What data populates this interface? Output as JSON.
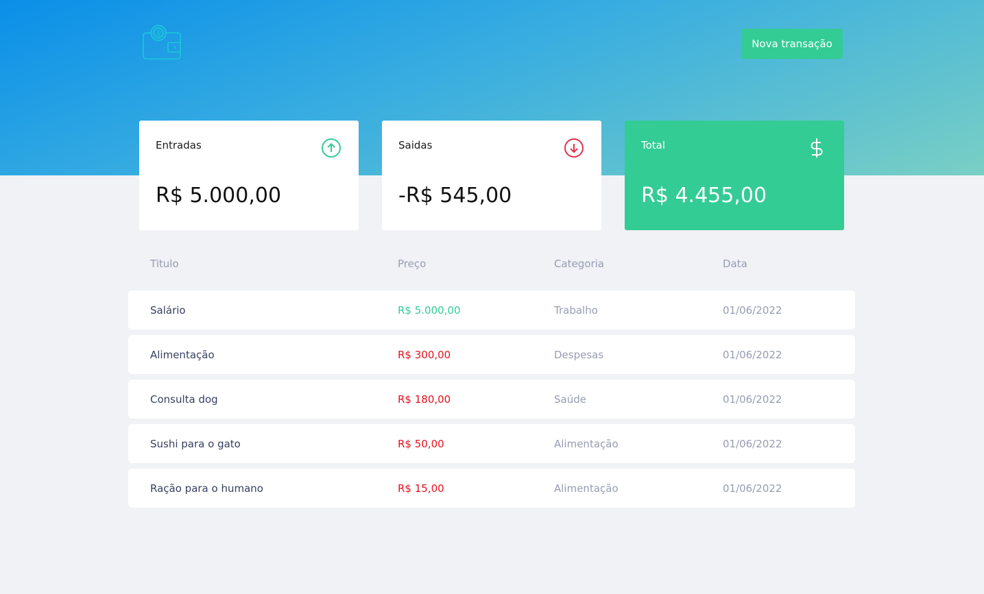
{
  "header": {
    "logo_icon": "wallet-dollar-icon",
    "new_transaction_label": "Nova transação"
  },
  "summary": {
    "income": {
      "label": "Entradas",
      "value": "R$ 5.000,00",
      "icon": "arrow-up-circle-icon",
      "color": "#33cc95"
    },
    "outcome": {
      "label": "Saidas",
      "value": "-R$ 545,00",
      "icon": "arrow-down-circle-icon",
      "color": "#e52e4d"
    },
    "total": {
      "label": "Total",
      "value": "R$ 4.455,00",
      "icon": "dollar-sign-icon",
      "color": "#33cc95"
    }
  },
  "table": {
    "headers": {
      "title": "Titulo",
      "price": "Preço",
      "category": "Categoria",
      "date": "Data"
    },
    "rows": [
      {
        "title": "Salário",
        "price": "R$ 5.000,00",
        "type": "deposit",
        "category": "Trabalho",
        "date": "01/06/2022"
      },
      {
        "title": "Alimentação",
        "price": "R$ 300,00",
        "type": "withdraw",
        "category": "Despesas",
        "date": "01/06/2022"
      },
      {
        "title": "Consulta dog",
        "price": "R$ 180,00",
        "type": "withdraw",
        "category": "Saúde",
        "date": "01/06/2022"
      },
      {
        "title": "Sushi para o gato",
        "price": "R$ 50,00",
        "type": "withdraw",
        "category": "Alimentação",
        "date": "01/06/2022"
      },
      {
        "title": "Ração para o humano",
        "price": "R$ 15,00",
        "type": "withdraw",
        "category": "Alimentação",
        "date": "01/06/2022"
      }
    ]
  },
  "colors": {
    "header_gradient_start": "#0a8fe8",
    "header_gradient_end": "#79cfc4",
    "deposit": "#33cc95",
    "withdraw": "#e5101b",
    "background": "#f0f2f5"
  }
}
